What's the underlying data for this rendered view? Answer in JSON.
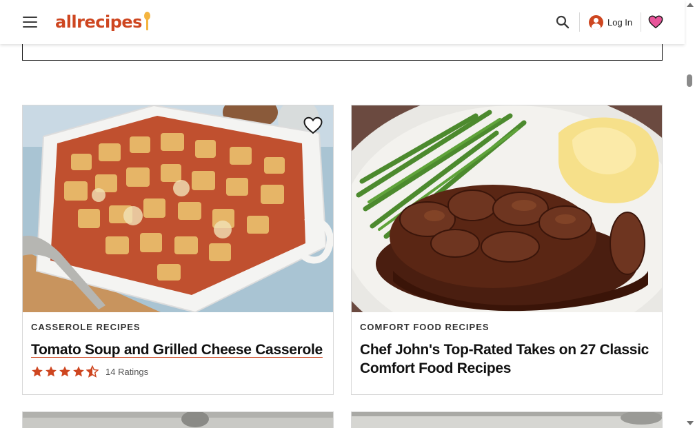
{
  "header": {
    "logo_text": "allrecipes",
    "menu_icon": "hamburger-menu-icon",
    "search_icon": "search-icon",
    "login_label": "Log In",
    "favorites_icon": "heart-icon"
  },
  "colors": {
    "brand": "#ce4620",
    "accent_gold": "#f4b43f",
    "heart_pink": "#e8559a"
  },
  "cards": [
    {
      "tag": "CASSEROLE RECIPES",
      "title": "Tomato Soup and Grilled Cheese Casserole",
      "rating": 4.5,
      "ratings_label": "14 Ratings",
      "image": "tomato-soup-grilled-cheese-casserole-photo"
    },
    {
      "tag": "COMFORT FOOD RECIPES",
      "title": "Chef John's Top-Rated Takes on 27 Classic Comfort Food Recipes",
      "image": "salisbury-steak-mashed-potatoes-photo"
    }
  ]
}
